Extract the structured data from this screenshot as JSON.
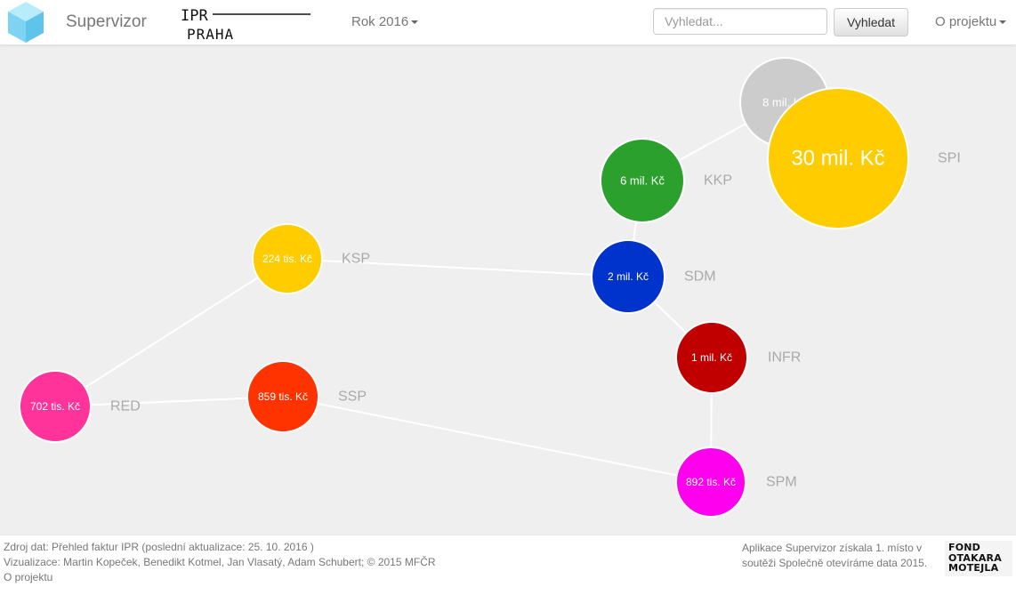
{
  "navbar": {
    "brand_name": "Supervizor",
    "ipr_logo_line1": "IPR",
    "ipr_logo_line2": "PRAHA",
    "year_label": "Rok 2016",
    "search_placeholder": "Vyhledat...",
    "search_button": "Vyhledat",
    "about_label": "O projektu"
  },
  "graph": {
    "colors": {
      "background": "#efefef",
      "edge": "#ffffff",
      "node_label": "#aaaaaa",
      "value_text": "#ffffff"
    },
    "nodes": [
      {
        "id": "X8",
        "label": "",
        "value": "8 mil. Kč",
        "color": "#cccccc"
      },
      {
        "id": "SPI",
        "label": "SPI",
        "value": "30 mil. Kč",
        "color": "#ffcc00"
      },
      {
        "id": "KKP",
        "label": "KKP",
        "value": "6 mil. Kč",
        "color": "#2ca02c"
      },
      {
        "id": "KSP",
        "label": "KSP",
        "value": "224 tis. Kč",
        "color": "#ffcc00"
      },
      {
        "id": "SDM",
        "label": "SDM",
        "value": "2 mil. Kč",
        "color": "#0033cc"
      },
      {
        "id": "INFR",
        "label": "INFR",
        "value": "1 mil. Kč",
        "color": "#c00000"
      },
      {
        "id": "RED",
        "label": "RED",
        "value": "702 tis. Kč",
        "color": "#ff3399"
      },
      {
        "id": "SSP",
        "label": "SSP",
        "value": "859 tis. Kč",
        "color": "#ff3300"
      },
      {
        "id": "SPM",
        "label": "SPM",
        "value": "892 tis. Kč",
        "color": "#ff00ee"
      }
    ],
    "edges": [
      [
        "X8",
        "KKP"
      ],
      [
        "KKP",
        "SDM"
      ],
      [
        "KSP",
        "SDM"
      ],
      [
        "KSP",
        "RED"
      ],
      [
        "RED",
        "SSP"
      ],
      [
        "SSP",
        "SPM"
      ],
      [
        "SDM",
        "INFR"
      ],
      [
        "INFR",
        "SPM"
      ]
    ]
  },
  "footer": {
    "source": "Zdroj dat: Přehled faktur IPR (poslední aktualizace: 25. 10. 2016 )",
    "credits": "Vizualizace: Martin Kopeček, Benedikt Kotmel, Jan Vlasatý, Adam Schubert; © 2015 MFČR",
    "about_link": "O projektu",
    "award": "Aplikace Supervizor získala 1. místo v soutěži Společně otevíráme data 2015.",
    "fund_logo_lines": [
      "FOND",
      "OTAKARA",
      "MOTEJLA"
    ]
  }
}
